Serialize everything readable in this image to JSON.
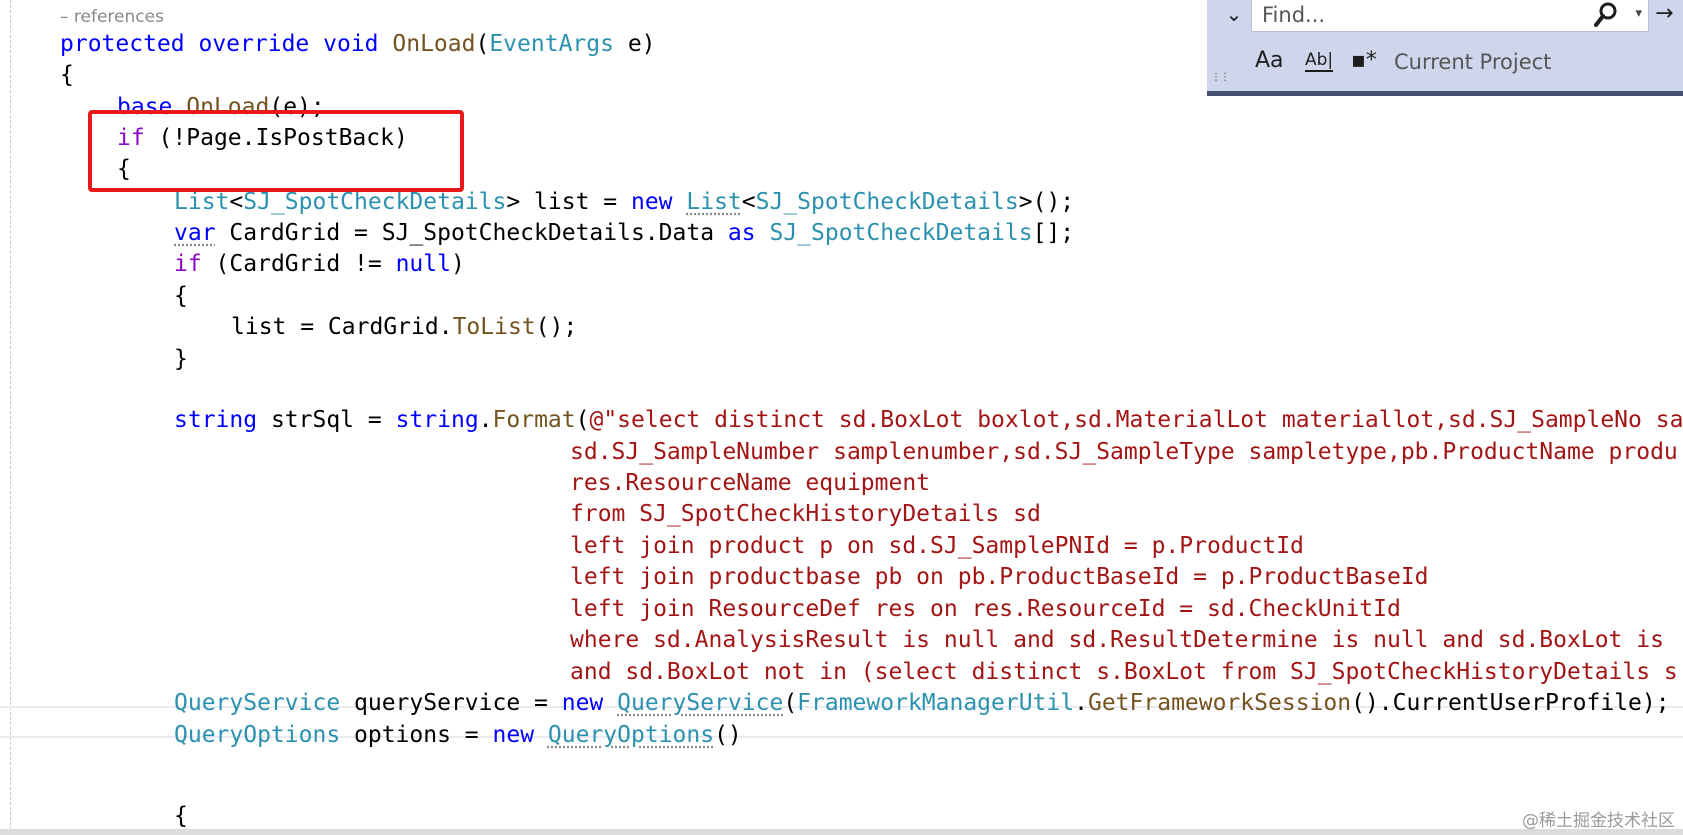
{
  "editor": {
    "codelens": "– references",
    "lines": {
      "l1": [
        "protected",
        "override",
        "void",
        "OnLoad",
        "EventArgs",
        "e"
      ],
      "l2": "{",
      "l3": [
        "base",
        "OnLoad",
        "(e);"
      ],
      "l4": [
        "if",
        " (!Page.IsPostBack)"
      ],
      "l5": "{",
      "l6": [
        "List",
        "<",
        "SJ_SpotCheckDetails",
        "> list = ",
        "new",
        " ",
        "List",
        "<",
        "SJ_SpotCheckDetails",
        ">();"
      ],
      "l7": [
        "var",
        " CardGrid = SJ_SpotCheckDetails.Data ",
        "as",
        " ",
        "SJ_SpotCheckDetails",
        "[];"
      ],
      "l8": [
        "if",
        " (CardGrid != ",
        "null",
        ")"
      ],
      "l9": "{",
      "l10": [
        "list = CardGrid.",
        "ToList",
        "();"
      ],
      "l11": "}",
      "l12": [
        "string",
        " strSql = ",
        "string",
        ".",
        "Format",
        "(",
        "@\"select distinct sd.BoxLot boxlot,sd.MaterialLot materiallot,sd.SJ_SampleNo sa"
      ],
      "l13": "sd.SJ_SampleNumber samplenumber,sd.SJ_SampleType sampletype,pb.ProductName produ",
      "l14": "res.ResourceName equipment",
      "l15": "from SJ_SpotCheckHistoryDetails sd",
      "l16": "left join product p on sd.SJ_SamplePNId = p.ProductId",
      "l17": "left join productbase pb on pb.ProductBaseId = p.ProductBaseId",
      "l18": "left join ResourceDef res on res.ResourceId = sd.CheckUnitId",
      "l19": "where sd.AnalysisResult is null and sd.ResultDetermine is null and sd.BoxLot is",
      "l20": "and sd.BoxLot not in (select distinct s.BoxLot from SJ_SpotCheckHistoryDetails s",
      "l21": [
        "QueryService",
        " queryService = ",
        "new",
        " ",
        "QueryService",
        "(",
        "FrameworkManagerUtil",
        ".",
        "GetFrameworkSession",
        "().CurrentUserProfile);"
      ],
      "l22": [
        "QueryOptions",
        " options = ",
        "new",
        " ",
        "QueryOptions",
        "()"
      ],
      "l23": "{"
    }
  },
  "find": {
    "toggle": "⌄",
    "placeholder": "Find...",
    "search_chevron": "▾",
    "next": "→",
    "match_case": "Aa",
    "whole_word": "Ab|",
    "regex": "▪*",
    "scope": "Current Project",
    "grip": "⋮⋮"
  },
  "watermark": "@稀土掘金技术社区",
  "colors": {
    "keyword": "#0000ff",
    "control": "#8f08c4",
    "type": "#2b91af",
    "method": "#74531f",
    "string": "#a31515",
    "highlight": "#e8191a",
    "find_panel": "#cfd6ec"
  }
}
